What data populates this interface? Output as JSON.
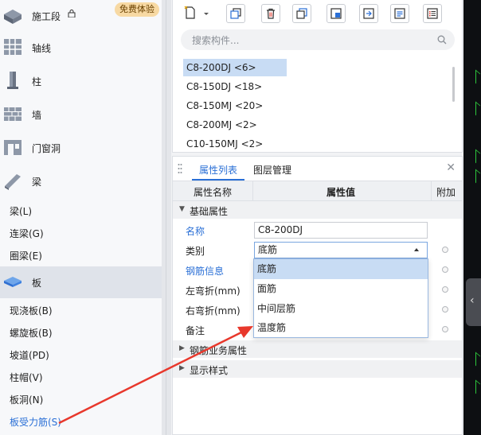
{
  "nav": {
    "big_items": [
      {
        "label": "施工段",
        "icon": "stage-icon"
      },
      {
        "label": "轴线",
        "icon": "axis-grid-icon"
      },
      {
        "label": "柱",
        "icon": "column-icon"
      },
      {
        "label": "墙",
        "icon": "wall-icon"
      },
      {
        "label": "门窗洞",
        "icon": "door-window-icon"
      },
      {
        "label": "梁",
        "icon": "beam-icon"
      }
    ],
    "badge": "免费体验",
    "beam_sub": [
      "梁(L)",
      "连梁(G)",
      "圈梁(E)"
    ],
    "slab": {
      "label": "板",
      "icon": "slab-icon"
    },
    "slab_sub": [
      "现浇板(B)",
      "螺旋板(B)",
      "坡道(PD)",
      "柱帽(V)",
      "板洞(N)",
      "板受力筋(S)"
    ]
  },
  "component_list": {
    "search_placeholder": "搜索构件...",
    "items": [
      "C8-200DJ <6>",
      "C8-150DJ <18>",
      "C8-150MJ <20>",
      "C8-200MJ <2>",
      "C10-150MJ <2>"
    ],
    "selected_index": 0
  },
  "properties": {
    "tabs": [
      "属性列表",
      "图层管理"
    ],
    "active_tab": 0,
    "headers": {
      "name": "属性名称",
      "value": "属性值",
      "extra": "附加"
    },
    "groups": {
      "basic": "基础属性",
      "business": "钢筋业务属性",
      "display": "显示样式"
    },
    "rows": [
      {
        "key": "名称",
        "value": "C8-200DJ",
        "link": true
      },
      {
        "key": "类别",
        "value": "底筋",
        "link": false
      },
      {
        "key": "钢筋信息",
        "value": "",
        "link": true
      },
      {
        "key": "左弯折(mm)",
        "value": "",
        "link": false
      },
      {
        "key": "右弯折(mm)",
        "value": "",
        "link": false
      },
      {
        "key": "备注",
        "value": "",
        "link": false
      }
    ],
    "dropdown_options": [
      "底筋",
      "面筋",
      "中间层筋",
      "温度筋"
    ],
    "dropdown_selected": 0
  },
  "colors": {
    "accent": "#2a6fd6",
    "selection": "#c8dcf4",
    "arrow": "#e8382c",
    "badge_bg": "#f7d9a3"
  }
}
